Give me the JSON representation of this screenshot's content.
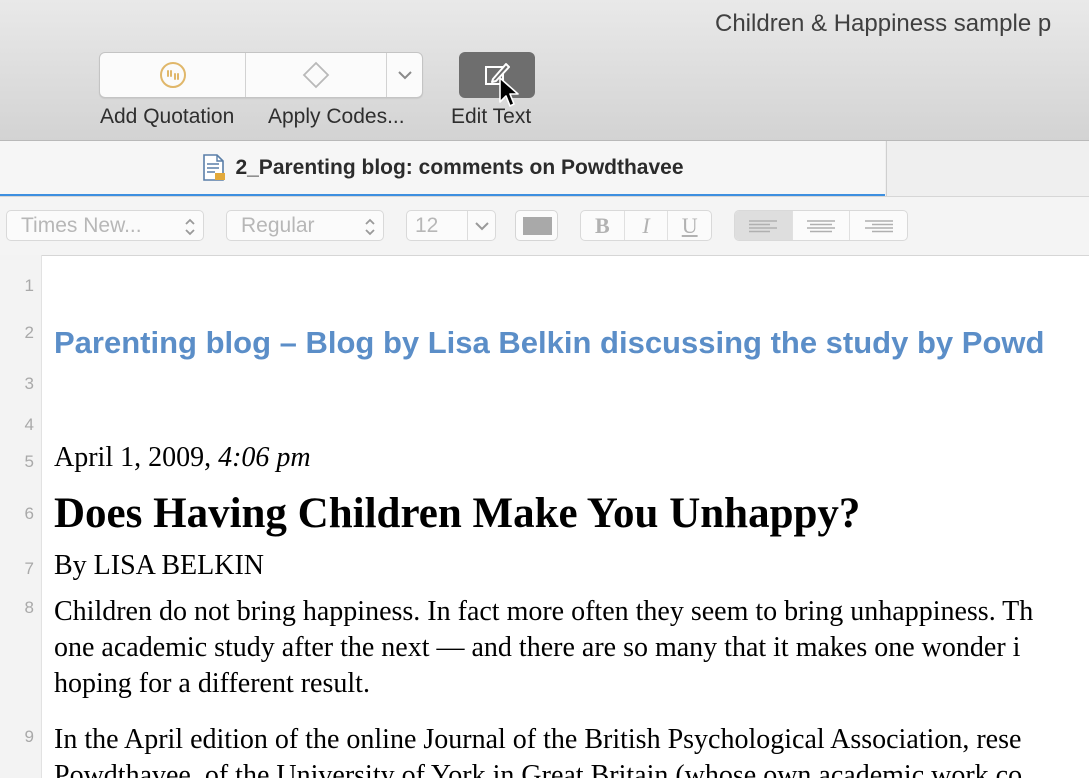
{
  "window": {
    "title": "Children & Happiness sample p"
  },
  "toolbar": {
    "add_quotation_label": "Add Quotation",
    "apply_codes_label": "Apply Codes...",
    "edit_text_label": "Edit Text"
  },
  "tab": {
    "label": "2_Parenting blog: comments on Powdthavee"
  },
  "format_bar": {
    "font_family": "Times New...",
    "font_style": "Regular",
    "font_size": "12",
    "bold": "B",
    "italic": "I",
    "underline": "U",
    "text_color": "#a9a9a9",
    "selected_alignment": "left"
  },
  "line_numbers": [
    "1",
    "2",
    "3",
    "4",
    "5",
    "6",
    "7",
    "8",
    "9"
  ],
  "document": {
    "blog_heading": "Parenting blog – Blog by Lisa Belkin discussing the study by Powd",
    "date": "April 1, 2009, ",
    "time": "4:06 pm",
    "article_title": "Does Having Children Make You Unhappy?",
    "byline": "By LISA BELKIN",
    "paragraph1": [
      "Children do not bring happiness. In fact more often they seem to bring unhappiness. Th",
      "one academic study after the next — and there are so many that it makes one wonder i",
      "hoping for a different result."
    ],
    "paragraph2": [
      "In the April edition of the online Journal of the British Psychological Association, rese",
      "Powdthavee, of the University of York in Great Britain (whose own academic work co"
    ]
  },
  "colors": {
    "heading_blue": "#5b8ec8",
    "tab_accent": "#3d8fe0",
    "active_button": "#6e6e6e"
  },
  "icons": [
    "quotation-icon",
    "apply-codes-diamond-icon",
    "chevron-down-icon",
    "edit-text-icon",
    "document-icon",
    "pointer-cursor-icon",
    "align-left-icon",
    "align-center-icon",
    "align-right-icon"
  ]
}
